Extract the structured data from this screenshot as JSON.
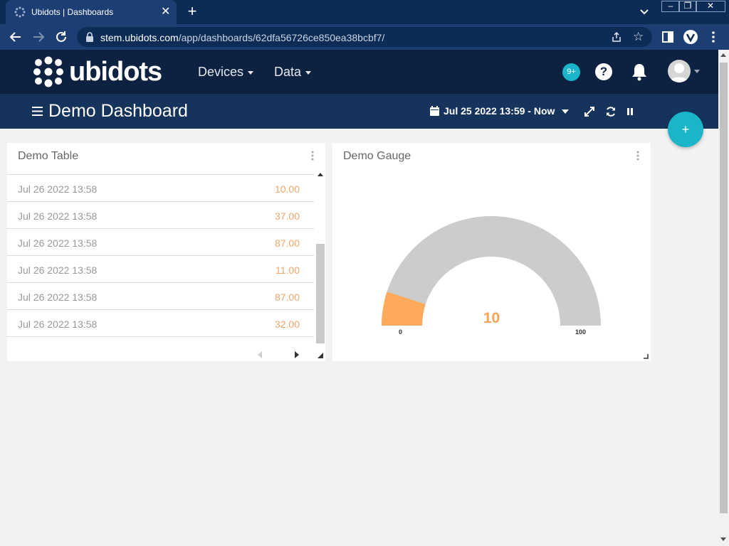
{
  "browser": {
    "tab_title": "Ubidots | Dashboards",
    "url_host": "stem.ubidots.com",
    "url_path": "/app/dashboards/62dfa56726ce850ea38bcbf7/"
  },
  "header": {
    "brand": "ubidots",
    "nav": [
      {
        "label": "Devices"
      },
      {
        "label": "Data"
      }
    ],
    "notifications_badge": "9+",
    "help_label": "?"
  },
  "dashboard": {
    "title": "Demo Dashboard",
    "date_range": "Jul 25 2022 13:59 - Now",
    "add_label": "+"
  },
  "table_widget": {
    "title": "Demo Table",
    "rows": [
      {
        "timestamp": "Jul 26 2022 13:58",
        "value": "10.00"
      },
      {
        "timestamp": "Jul 26 2022 13:58",
        "value": "37.00"
      },
      {
        "timestamp": "Jul 26 2022 13:58",
        "value": "87.00"
      },
      {
        "timestamp": "Jul 26 2022 13:58",
        "value": "11.00"
      },
      {
        "timestamp": "Jul 26 2022 13:58",
        "value": "87.00"
      },
      {
        "timestamp": "Jul 26 2022 13:58",
        "value": "32.00"
      }
    ]
  },
  "gauge_widget": {
    "title": "Demo Gauge",
    "value": "10",
    "value_num": 10,
    "min": "0",
    "max": "100",
    "fill_color": "#fdab5b",
    "track_color": "#cccccc"
  },
  "colors": {
    "accent": "#1ab5c8",
    "header_bg": "#0d2140",
    "dashbar_bg": "#16335c",
    "value_color": "#f5a46a"
  }
}
